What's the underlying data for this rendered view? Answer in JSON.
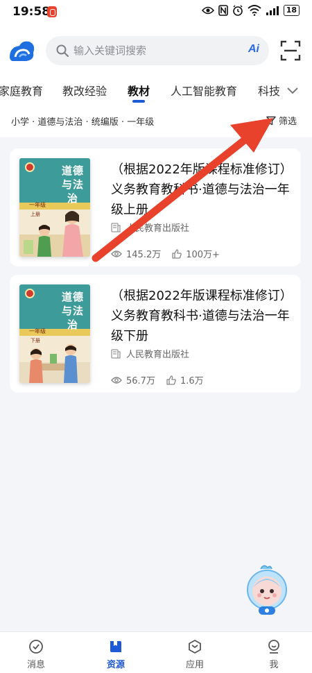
{
  "status_bar": {
    "time": "19:58",
    "battery": "18"
  },
  "search": {
    "placeholder": "输入关键词搜索",
    "ai_label": "Ai"
  },
  "tabs": [
    {
      "label": "家庭教育",
      "active": false
    },
    {
      "label": "教改经验",
      "active": false
    },
    {
      "label": "教材",
      "active": true
    },
    {
      "label": "人工智能教育",
      "active": false
    },
    {
      "label": "科技",
      "active": false
    }
  ],
  "filter_row": {
    "breadcrumb": "小学 · 道德与法治 · 统编版 · 一年级",
    "filter_label": "筛选"
  },
  "books": [
    {
      "title": "（根据2022年版课程标准修订）义务教育教科书·道德与法治一年级上册",
      "publisher": "人民教育出版社",
      "views": "145.2万",
      "likes": "100万+",
      "cover_title": "道德与法治",
      "cover_grade": "一年级",
      "cover_volume": "上册"
    },
    {
      "title": "（根据2022年版课程标准修订）义务教育教科书·道德与法治一年级下册",
      "publisher": "人民教育出版社",
      "views": "56.7万",
      "likes": "1.6万",
      "cover_title": "道德与法治",
      "cover_grade": "一年级",
      "cover_volume": "下册"
    }
  ],
  "bottom_nav": [
    {
      "label": "消息",
      "icon": "message-icon",
      "active": false
    },
    {
      "label": "资源",
      "icon": "book-icon",
      "active": true
    },
    {
      "label": "应用",
      "icon": "apps-icon",
      "active": false
    },
    {
      "label": "我",
      "icon": "profile-icon",
      "active": false
    }
  ],
  "colors": {
    "accent": "#1e5ad6",
    "annotation": "#e8412c",
    "background": "#f3f5f8"
  }
}
